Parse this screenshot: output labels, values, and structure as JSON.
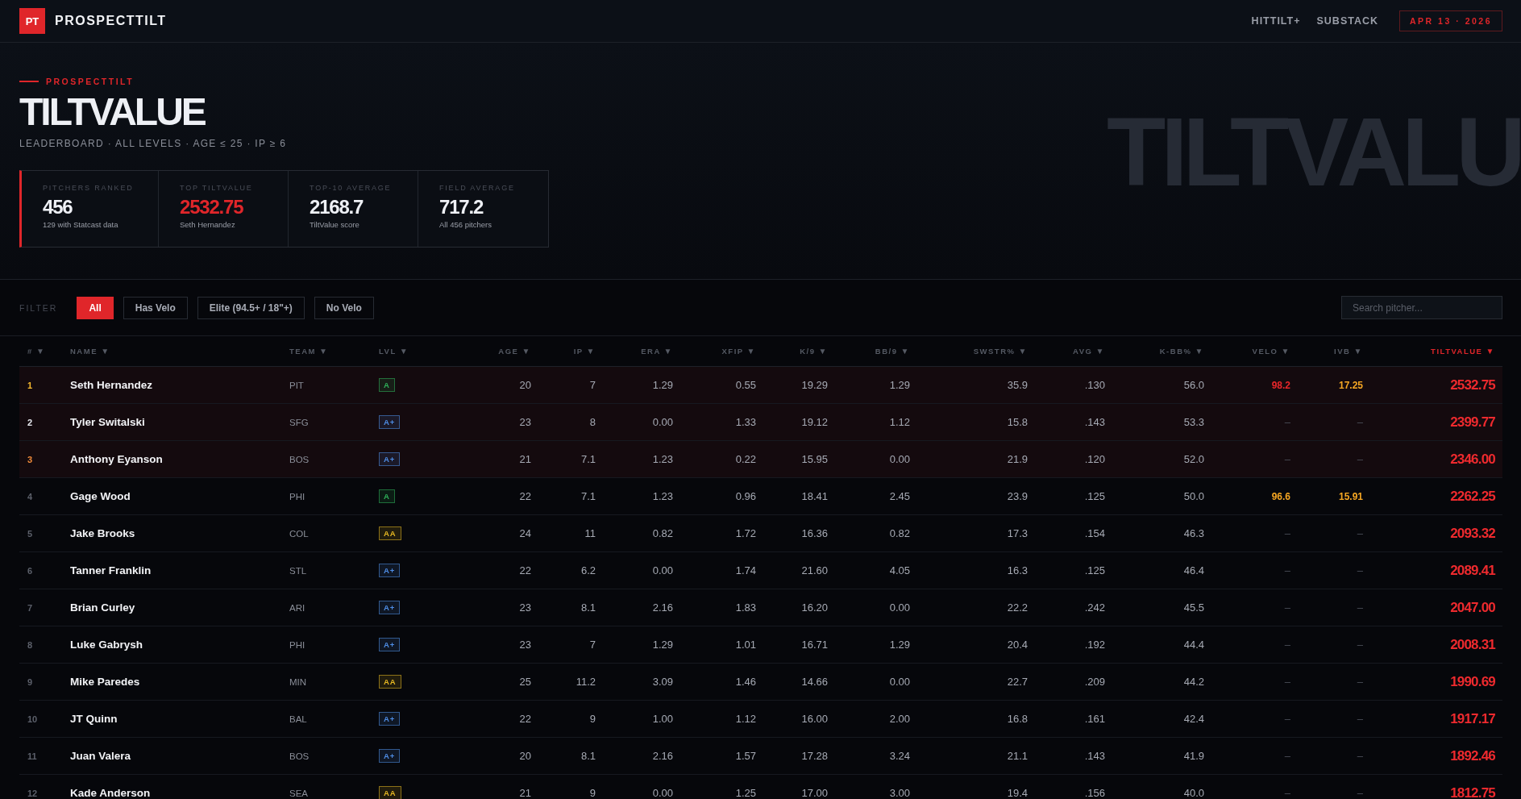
{
  "brand": {
    "logo": "PT",
    "name": "PROSPECTTILT"
  },
  "nav": [
    {
      "label": "HITTILT+"
    },
    {
      "label": "SUBSTACK"
    }
  ],
  "date_badge": "APR 13 · 2026",
  "hero": {
    "eyebrow": "PROSPECTTILT",
    "title": "TILTVALUE",
    "subtitle": "LEADERBOARD · ALL LEVELS · AGE ≤ 25 · IP ≥ 6",
    "watermark": "TILTVALU"
  },
  "stats": [
    {
      "label": "PITCHERS RANKED",
      "value": "456",
      "note": "129 with Statcast data",
      "accent": false
    },
    {
      "label": "TOP TILTVALUE",
      "value": "2532.75",
      "note": "Seth Hernandez",
      "accent": true
    },
    {
      "label": "TOP-10 AVERAGE",
      "value": "2168.7",
      "note": "TiltValue score",
      "accent": false
    },
    {
      "label": "FIELD AVERAGE",
      "value": "717.2",
      "note": "All 456 pitchers",
      "accent": false
    }
  ],
  "filter": {
    "label": "FILTER",
    "options": [
      {
        "label": "All",
        "selected": true
      },
      {
        "label": "Has Velo",
        "selected": false
      },
      {
        "label": "Elite (94.5+ / 18\"+)",
        "selected": false
      },
      {
        "label": "No Velo",
        "selected": false
      }
    ],
    "search_placeholder": "Search pitcher..."
  },
  "table": {
    "columns": [
      {
        "label": "#",
        "arrow": "▼",
        "selected": false
      },
      {
        "label": "NAME",
        "arrow": "▼",
        "selected": false
      },
      {
        "label": "TEAM",
        "arrow": "▼",
        "selected": false
      },
      {
        "label": "LVL",
        "arrow": "▼",
        "selected": false
      },
      {
        "label": "AGE",
        "arrow": "▼",
        "selected": false
      },
      {
        "label": "IP",
        "arrow": "▼",
        "selected": false
      },
      {
        "label": "ERA",
        "arrow": "▼",
        "selected": false
      },
      {
        "label": "XFIP",
        "arrow": "▼",
        "selected": false
      },
      {
        "label": "K/9",
        "arrow": "▼",
        "selected": false
      },
      {
        "label": "BB/9",
        "arrow": "▼",
        "selected": false
      },
      {
        "label": "SWSTR%",
        "arrow": "▼",
        "selected": false
      },
      {
        "label": "AVG",
        "arrow": "▼",
        "selected": false
      },
      {
        "label": "K-BB%",
        "arrow": "▼",
        "selected": false
      },
      {
        "label": "VELO",
        "arrow": "▼",
        "selected": false
      },
      {
        "label": "IVB",
        "arrow": "▼",
        "selected": false
      },
      {
        "label": "TILTVALUE",
        "arrow": "▼",
        "selected": true
      }
    ],
    "rows": [
      {
        "rank": "1",
        "color": "#f5b82e",
        "highlighted": true,
        "name": "Seth Hernandez",
        "team": "PIT",
        "level": {
          "text": "A",
          "color": "#2fb35a"
        },
        "age": "20",
        "ip": "7",
        "era": "1.29",
        "xfip": "0.55",
        "k9": "19.29",
        "bb9": "1.29",
        "swstr": "35.9",
        "avg": ".130",
        "kbb": "56.0",
        "velo": {
          "text": "98.2",
          "color": "#e8262a"
        },
        "ivb": {
          "text": "17.25",
          "color": "#f5a623"
        },
        "tiltvalue": "2532.75"
      },
      {
        "rank": "2",
        "color": "#e6e8ee",
        "highlighted": true,
        "name": "Tyler Switalski",
        "team": "SFG",
        "level": {
          "text": "A+",
          "color": "#4f8fe8"
        },
        "age": "23",
        "ip": "8",
        "era": "0.00",
        "xfip": "1.33",
        "k9": "19.12",
        "bb9": "1.12",
        "swstr": "15.8",
        "avg": ".143",
        "kbb": "53.3",
        "velo": {
          "text": "–"
        },
        "ivb": {
          "text": "–"
        },
        "tiltvalue": "2399.77"
      },
      {
        "rank": "3",
        "color": "#f08a3a",
        "highlighted": true,
        "name": "Anthony Eyanson",
        "team": "BOS",
        "level": {
          "text": "A+",
          "color": "#4f8fe8"
        },
        "age": "21",
        "ip": "7.1",
        "era": "1.23",
        "xfip": "0.22",
        "k9": "15.95",
        "bb9": "0.00",
        "swstr": "21.9",
        "avg": ".120",
        "kbb": "52.0",
        "velo": {
          "text": "–"
        },
        "ivb": {
          "text": "–"
        },
        "tiltvalue": "2346.00"
      },
      {
        "rank": "4",
        "color": "#5c606b",
        "highlighted": false,
        "name": "Gage Wood",
        "team": "PHI",
        "level": {
          "text": "A",
          "color": "#2fb35a"
        },
        "age": "22",
        "ip": "7.1",
        "era": "1.23",
        "xfip": "0.96",
        "k9": "18.41",
        "bb9": "2.45",
        "swstr": "23.9",
        "avg": ".125",
        "kbb": "50.0",
        "velo": {
          "text": "96.6",
          "color": "#f5a623"
        },
        "ivb": {
          "text": "15.91",
          "color": "#f5a623"
        },
        "tiltvalue": "2262.25"
      },
      {
        "rank": "5",
        "color": "#5c606b",
        "highlighted": false,
        "name": "Jake Brooks",
        "team": "COL",
        "level": {
          "text": "AA",
          "color": "#e8b923"
        },
        "age": "24",
        "ip": "11",
        "era": "0.82",
        "xfip": "1.72",
        "k9": "16.36",
        "bb9": "0.82",
        "swstr": "17.3",
        "avg": ".154",
        "kbb": "46.3",
        "velo": {
          "text": "–"
        },
        "ivb": {
          "text": "–"
        },
        "tiltvalue": "2093.32"
      },
      {
        "rank": "6",
        "color": "#5c606b",
        "highlighted": false,
        "name": "Tanner Franklin",
        "team": "STL",
        "level": {
          "text": "A+",
          "color": "#4f8fe8"
        },
        "age": "22",
        "ip": "6.2",
        "era": "0.00",
        "xfip": "1.74",
        "k9": "21.60",
        "bb9": "4.05",
        "swstr": "16.3",
        "avg": ".125",
        "kbb": "46.4",
        "velo": {
          "text": "–"
        },
        "ivb": {
          "text": "–"
        },
        "tiltvalue": "2089.41"
      },
      {
        "rank": "7",
        "color": "#5c606b",
        "highlighted": false,
        "name": "Brian Curley",
        "team": "ARI",
        "level": {
          "text": "A+",
          "color": "#4f8fe8"
        },
        "age": "23",
        "ip": "8.1",
        "era": "2.16",
        "xfip": "1.83",
        "k9": "16.20",
        "bb9": "0.00",
        "swstr": "22.2",
        "avg": ".242",
        "kbb": "45.5",
        "velo": {
          "text": "–"
        },
        "ivb": {
          "text": "–"
        },
        "tiltvalue": "2047.00"
      },
      {
        "rank": "8",
        "color": "#5c606b",
        "highlighted": false,
        "name": "Luke Gabrysh",
        "team": "PHI",
        "level": {
          "text": "A+",
          "color": "#4f8fe8"
        },
        "age": "23",
        "ip": "7",
        "era": "1.29",
        "xfip": "1.01",
        "k9": "16.71",
        "bb9": "1.29",
        "swstr": "20.4",
        "avg": ".192",
        "kbb": "44.4",
        "velo": {
          "text": "–"
        },
        "ivb": {
          "text": "–"
        },
        "tiltvalue": "2008.31"
      },
      {
        "rank": "9",
        "color": "#5c606b",
        "highlighted": false,
        "name": "Mike Paredes",
        "team": "MIN",
        "level": {
          "text": "AA",
          "color": "#e8b923"
        },
        "age": "25",
        "ip": "11.2",
        "era": "3.09",
        "xfip": "1.46",
        "k9": "14.66",
        "bb9": "0.00",
        "swstr": "22.7",
        "avg": ".209",
        "kbb": "44.2",
        "velo": {
          "text": "–"
        },
        "ivb": {
          "text": "–"
        },
        "tiltvalue": "1990.69"
      },
      {
        "rank": "10",
        "color": "#5c606b",
        "highlighted": false,
        "name": "JT Quinn",
        "team": "BAL",
        "level": {
          "text": "A+",
          "color": "#4f8fe8"
        },
        "age": "22",
        "ip": "9",
        "era": "1.00",
        "xfip": "1.12",
        "k9": "16.00",
        "bb9": "2.00",
        "swstr": "16.8",
        "avg": ".161",
        "kbb": "42.4",
        "velo": {
          "text": "–"
        },
        "ivb": {
          "text": "–"
        },
        "tiltvalue": "1917.17"
      },
      {
        "rank": "11",
        "color": "#5c606b",
        "highlighted": false,
        "name": "Juan Valera",
        "team": "BOS",
        "level": {
          "text": "A+",
          "color": "#4f8fe8"
        },
        "age": "20",
        "ip": "8.1",
        "era": "2.16",
        "xfip": "1.57",
        "k9": "17.28",
        "bb9": "3.24",
        "swstr": "21.1",
        "avg": ".143",
        "kbb": "41.9",
        "velo": {
          "text": "–"
        },
        "ivb": {
          "text": "–"
        },
        "tiltvalue": "1892.46"
      },
      {
        "rank": "12",
        "color": "#5c606b",
        "highlighted": false,
        "name": "Kade Anderson",
        "team": "SEA",
        "level": {
          "text": "AA",
          "color": "#e8b923"
        },
        "age": "21",
        "ip": "9",
        "era": "0.00",
        "xfip": "1.25",
        "k9": "17.00",
        "bb9": "3.00",
        "swstr": "19.4",
        "avg": ".156",
        "kbb": "40.0",
        "velo": {
          "text": "–"
        },
        "ivb": {
          "text": "–"
        },
        "tiltvalue": "1812.75"
      }
    ]
  }
}
